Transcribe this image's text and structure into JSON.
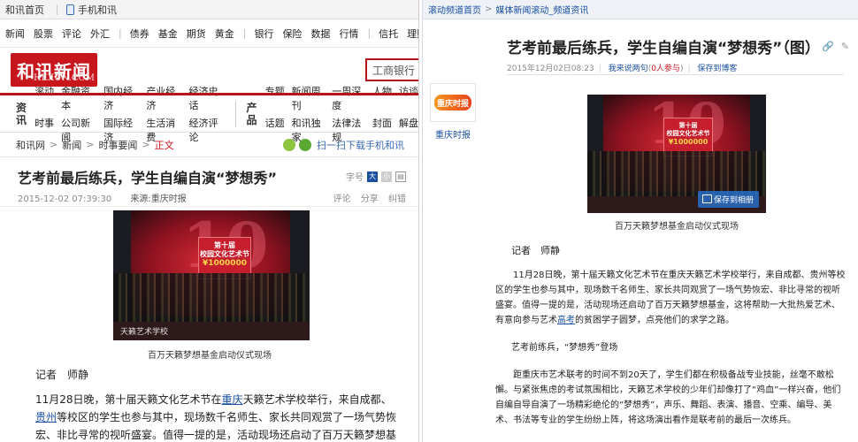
{
  "left": {
    "topbar": {
      "home": "和讯首页",
      "mobile": "手机和讯"
    },
    "channels": [
      "新闻",
      "股票",
      "评论",
      "外汇",
      "债券",
      "基金",
      "期货",
      "黄金",
      "银行",
      "保险",
      "数据",
      "行情",
      "信托",
      "理财",
      "收藏",
      "读书"
    ],
    "logo": {
      "text": "和讯新闻",
      "sub": "HEXUN.COM"
    },
    "search": {
      "value": "工商银行"
    },
    "nav": {
      "group1": {
        "label": "资讯",
        "items": [
          "滚动",
          "金融资本",
          "国内经济",
          "产业经济",
          "经济史话",
          "时事",
          "公司新闻",
          "国际经济",
          "生活消费",
          "经济评论"
        ]
      },
      "group2": {
        "label": "产品",
        "items": [
          "专题",
          "新闻周刊",
          "一周深度",
          "人物",
          "访谈",
          "话题",
          "和讯独家",
          "法律法规",
          "封面",
          "解盘"
        ]
      }
    },
    "breadcrumb": {
      "items": [
        "和讯网",
        "新闻",
        "时事要闻"
      ],
      "current": "正文",
      "download": "扫一扫下载手机和讯"
    },
    "article": {
      "title": "艺考前最后练兵，学生自编自演“梦想秀”",
      "tools": {
        "font": "字号",
        "a1": "大",
        "a2": "小"
      },
      "date": "2015-12-02 07:39:30",
      "source_label": "来源:",
      "source": "重庆时报",
      "ops": [
        "评论",
        "分享",
        "纠错"
      ],
      "photo": {
        "num": "10",
        "board_title": "第十届\n校园文化艺术节",
        "amount": "¥1000000",
        "watermark": "天籁艺术学校"
      },
      "caption": "百万天籁梦想基金启动仪式现场",
      "reporter": "记者　师静",
      "para1_a": "11月28日晚，第十届天籁文化艺术节在",
      "para1_link1": "重庆",
      "para1_b": "天籁艺术学校举行，来自成都、",
      "para1_link2": "贵州",
      "para1_c": "等校区的学生也参与其中，现场数千名师生、家长共同观赏了一场气势恢宏、非比寻常的视听盛宴。值得一提的是，活动现场还启动了百万天籁梦想基金，这将帮助一大批热爱艺术、有意向参与艺术高考"
    }
  },
  "right": {
    "breadcrumb": {
      "a": "滚动频道首页",
      "b": "媒体新闻滚动_频道资讯"
    },
    "title": "艺考前最后练兵，学生自编自演“梦想秀”（图）",
    "icons": [
      "🔗",
      "✎"
    ],
    "meta": {
      "date": "2015年12月02日08:23",
      "comments": "我来说两句",
      "count": "0人参与",
      "save": "保存到博客"
    },
    "avatar": {
      "mark": "重庆时报",
      "name": "重庆时报"
    },
    "photo": {
      "num": "10",
      "board_title": "第十届\n校园文化艺术节",
      "amount": "¥1000000",
      "save_btn": "保存到相册"
    },
    "caption": "百万天籁梦想基金启动仪式现场",
    "reporter": "记者　师静",
    "para1_a": "11月28日晚，第十届天籁文化艺术节在重庆天籁艺术学校举行，来自成都、贵州等校区的学生也参与其中，现场数千名师生、家长共同观赏了一场气势恢宏、非比寻常的视听盛宴。值得一提的是，活动现场还启动了百万天籁梦想基金，这将帮助一大批热爱艺术、有意向参与艺术",
    "para1_link": "高考",
    "para1_b": "的贫困学子圆梦，点亮他们的求学之路。",
    "subhead": "艺考前练兵，“梦想秀”登场",
    "para2": "距重庆市艺术联考的时间不到20天了，学生们都在积极备战专业技能，丝毫不敢松懈。与紧张焦虑的考试氛围相比，天籁艺术学校的少年们却像打了“鸡血”一样兴奋，他们自编自导自演了一场精彩绝伦的“梦想秀”，声乐、舞蹈、表演、播音、空乘、编导、美术、书法等专业的学生纷纷上阵，将这场演出看作是联考前的最后一次练兵。"
  }
}
